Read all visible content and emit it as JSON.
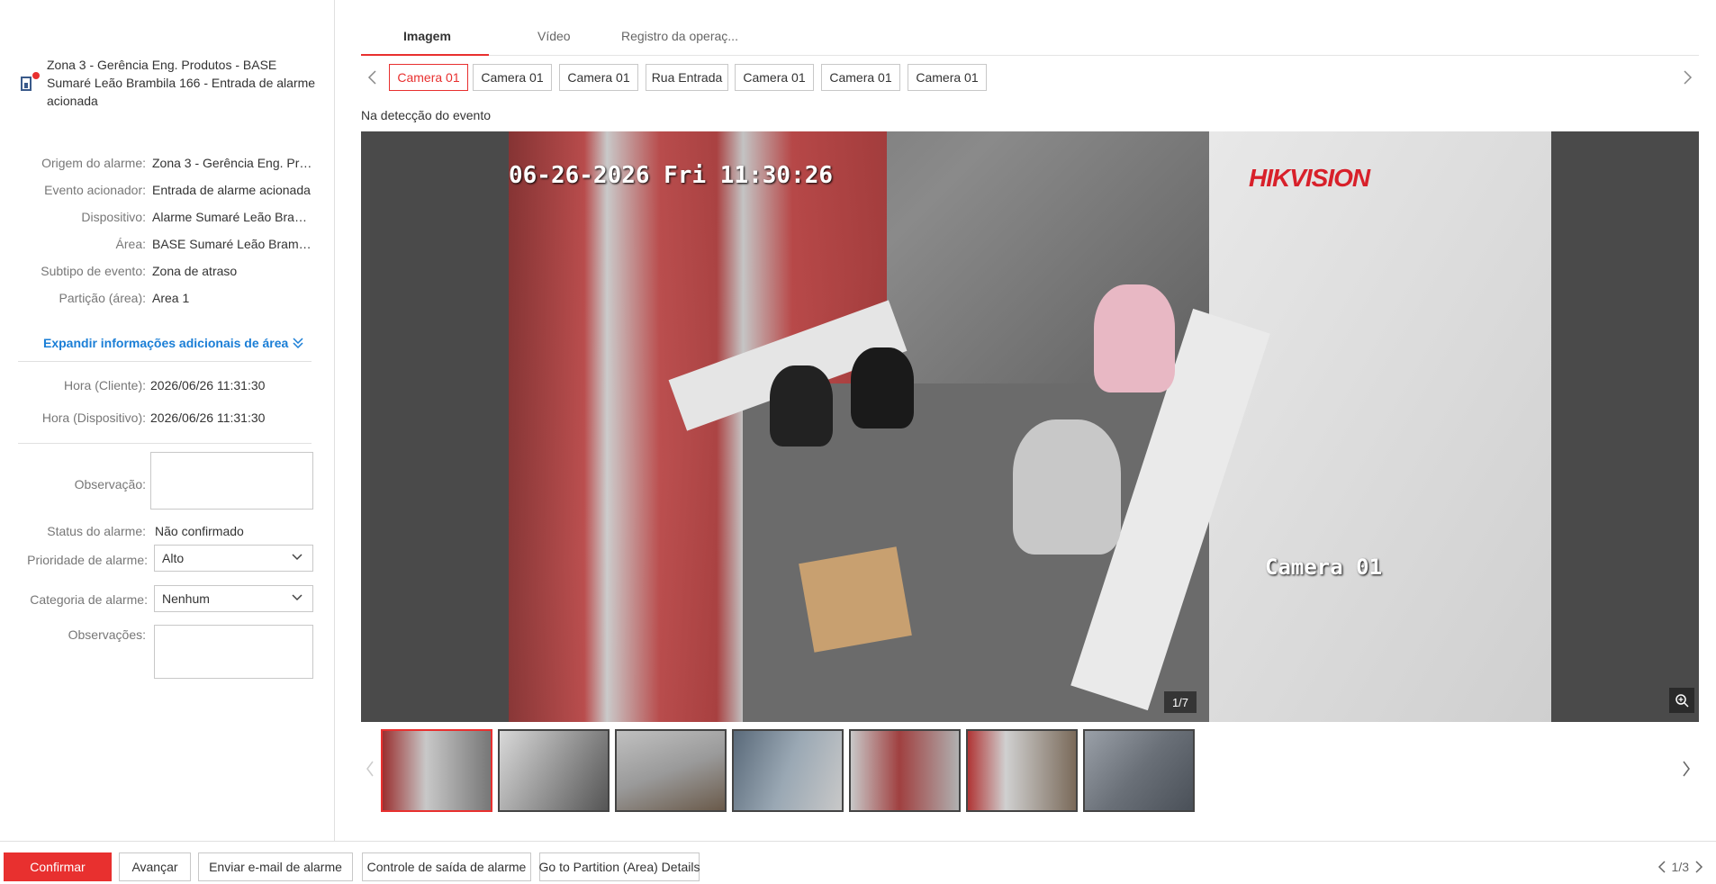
{
  "alarm": {
    "title": "Zona 3 - Gerência Eng. Produtos - BASE Sumaré Leão Brambila 166 - Entrada de alarme acionada"
  },
  "details": [
    {
      "label": "Origem do alarme:",
      "value": "Zona 3 - Gerência Eng. Pro..."
    },
    {
      "label": "Evento acionador:",
      "value": "Entrada de alarme acionada"
    },
    {
      "label": "Dispositivo:",
      "value": "Alarme Sumaré Leão Bram..."
    },
    {
      "label": "Área:",
      "value": "BASE Sumaré Leão Brambil..."
    },
    {
      "label": "Subtipo de evento:",
      "value": "Zona de atraso"
    },
    {
      "label": "Partição (área):",
      "value": "Area 1"
    }
  ],
  "expand_label": "Expandir informações adicionais de área",
  "times": [
    {
      "label": "Hora (Cliente):",
      "value": "2026/06/26 11:31:30"
    },
    {
      "label": "Hora (Dispositivo):",
      "value": "2026/06/26 11:31:30"
    }
  ],
  "form": {
    "observacao_label": "Observação:",
    "observacao_value": "",
    "status_label": "Status do alarme:",
    "status_value": "Não confirmado",
    "prioridade_label": "Prioridade de alarme:",
    "prioridade_value": "Alto",
    "categoria_label": "Categoria de alarme:",
    "categoria_value": "Nenhum",
    "observacoes_label": "Observações:",
    "observacoes_value": ""
  },
  "tabs": [
    "Imagem",
    "Vídeo",
    "Registro da operaç..."
  ],
  "cameras": [
    "Camera 01",
    "Camera 01",
    "Camera 01",
    "Rua Entrada",
    "Camera 01",
    "Camera 01",
    "Camera 01"
  ],
  "event_label": "Na detecção do evento",
  "viewer": {
    "osd_time": "06-26-2026 Fri 11:30:26",
    "osd_brand": "HIKVISION",
    "osd_camera": "Camera 01",
    "counter": "1/7"
  },
  "thumb_count": 7,
  "footer": {
    "confirm": "Confirmar",
    "next": "Avançar",
    "email": "Enviar e-mail de alarme",
    "output": "Controle de saída de alarme",
    "partition": "Go to Partition (Area) Details",
    "page": "1/3"
  },
  "colors": {
    "accent": "#e8302f",
    "link": "#1a7ed6"
  }
}
